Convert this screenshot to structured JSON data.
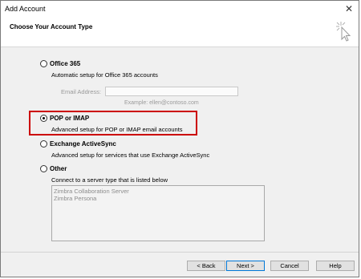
{
  "window": {
    "title": "Add Account",
    "close_label": "✕"
  },
  "header": {
    "title": "Choose Your Account Type",
    "icon": "wizard-cursor-icon"
  },
  "options": {
    "office365": {
      "label": "Office 365",
      "description": "Automatic setup for Office 365 accounts",
      "selected": false
    },
    "email": {
      "label": "Email Address:",
      "value": "",
      "example": "Example: ellen@contoso.com"
    },
    "pop_imap": {
      "label": "POP or IMAP",
      "description": "Advanced setup for POP or IMAP email accounts",
      "selected": true
    },
    "exchange_activesync": {
      "label": "Exchange ActiveSync",
      "description": "Advanced setup for services that use Exchange ActiveSync",
      "selected": false
    },
    "other": {
      "label": "Other",
      "description": "Connect to a server type that is listed below",
      "selected": false,
      "server_types": [
        "Zimbra Collaboration Server",
        "Zimbra Persona"
      ]
    }
  },
  "buttons": {
    "back": "< Back",
    "next": "Next >",
    "cancel": "Cancel",
    "help": "Help"
  },
  "highlight_color": "#cc0000"
}
